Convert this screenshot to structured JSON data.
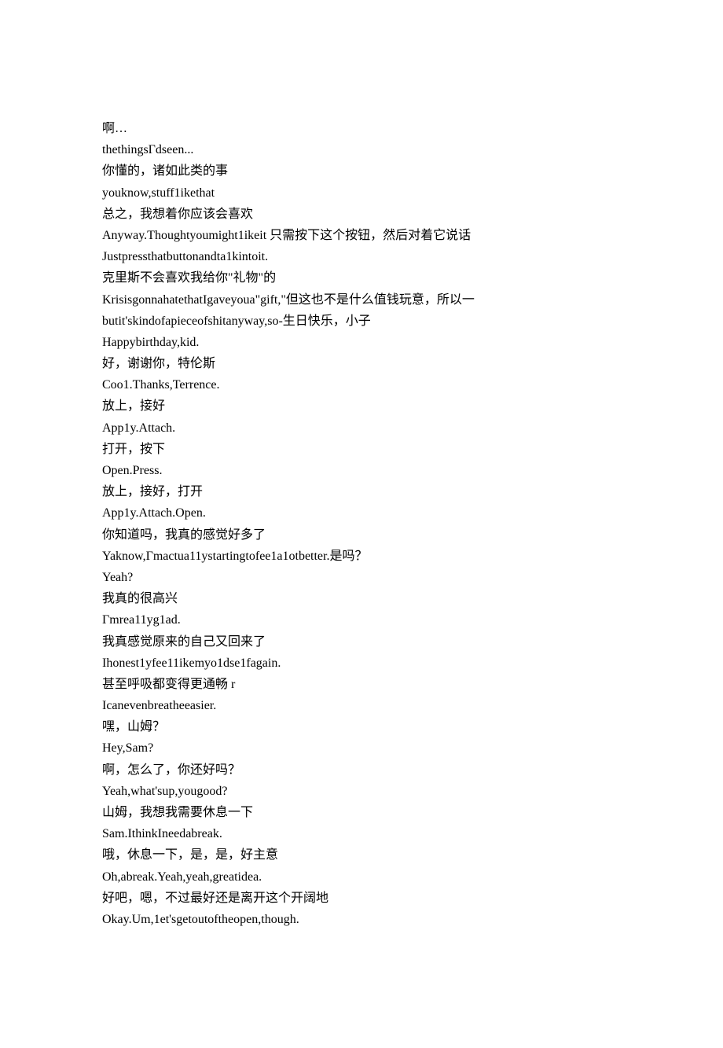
{
  "lines": [
    "啊…",
    "thethingsΓdseen...",
    "你懂的，诸如此类的事",
    "youknow,stuff1ikethat",
    "总之，我想着你应该会喜欢",
    "Anyway.Thoughtyoumight1ikeit 只需按下这个按钮，然后对着它说话",
    "Justpressthatbuttonandta1kintoit.",
    "克里斯不会喜欢我给你\"礼物\"的",
    "KrisisgonnahatethatIgaveyoua\"gift,\"但这也不是什么值钱玩意，所以一",
    "butit'skindofapieceofshitanyway,so-生日快乐，小子",
    "Happybirthday,kid.",
    "好，谢谢你，特伦斯",
    "Coo1.Thanks,Terrence.",
    "放上，接好",
    "App1y.Attach.",
    "打开，按下",
    "Open.Press.",
    "放上，接好，打开",
    "App1y.Attach.Open.",
    "你知道吗，我真的感觉好多了",
    "Yaknow,Γmactua11ystartingtofee1a1otbetter.是吗？",
    "Yeah?",
    "我真的很高兴",
    "Γmrea11yg1ad.",
    "我真感觉原来的自己又回来了",
    "Ihonest1yfee11ikemyo1dse1fagain.",
    "甚至呼吸都变得更通畅 r",
    "Icanevenbreatheeasier.",
    "嘿，山姆？",
    "Hey,Sam?",
    "啊，怎么了，你还好吗？",
    "Yeah,what'sup,yougood?",
    "山姆，我想我需要休息一下",
    "Sam.IthinkIneedabreak.",
    "哦，休息一下，是，是，好主意",
    "Oh,abreak.Yeah,yeah,greatidea.",
    "好吧，嗯，不过最好还是离开这个开阔地",
    "Okay.Um,1et'sgetoutoftheopen,though."
  ]
}
